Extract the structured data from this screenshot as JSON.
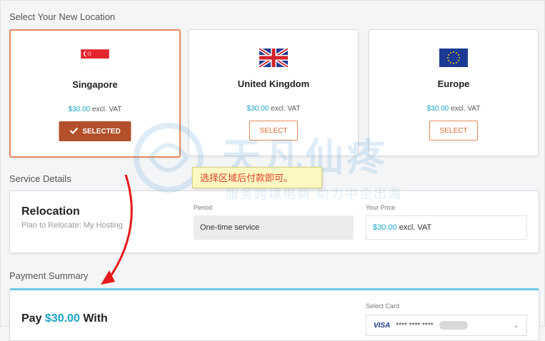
{
  "sections": {
    "location_title": "Select Your New Location",
    "service_title": "Service Details",
    "payment_title": "Payment Summary"
  },
  "locations": [
    {
      "name": "Singapore",
      "price": "$30.00",
      "price_suffix": "excl. VAT",
      "button": "SELECTED",
      "selected": true,
      "flag": "singapore-flag"
    },
    {
      "name": "United Kingdom",
      "price": "$30.00",
      "price_suffix": "excl. VAT",
      "button": "SELECT",
      "selected": false,
      "flag": "uk-flag"
    },
    {
      "name": "Europe",
      "price": "$30.00",
      "price_suffix": "excl. VAT",
      "button": "SELECT",
      "selected": false,
      "flag": "eu-flag"
    }
  ],
  "service": {
    "title": "Relocation",
    "subtitle": "Plan to Relocate: My Hosting",
    "period_label": "Period",
    "period_value": "One-time service",
    "price_label": "Your Price",
    "price_amount": "$30.00",
    "price_suffix": "excl. VAT"
  },
  "payment": {
    "title_prefix": "Pay",
    "amount": "$30.00",
    "title_suffix": "With",
    "card_label": "Select Card",
    "card_brand": "VISA",
    "card_masked": "**** **** ****"
  },
  "annotation": {
    "tooltip": "选择区域后付款即可。",
    "watermark_main": "天凡仙疼",
    "watermark_sub": "服务跨境电商 助力中企出海"
  },
  "colors": {
    "accent": "#1aa3c6",
    "select_orange": "#e06a2f",
    "selected_bg": "#b3502a",
    "arrow": "#e41a1a"
  }
}
